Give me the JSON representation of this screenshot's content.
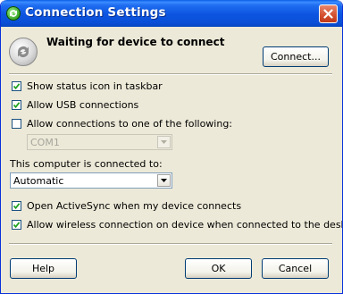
{
  "window": {
    "title": "Connection Settings"
  },
  "status": {
    "text": "Waiting for device to connect"
  },
  "buttons": {
    "connect": "Connect...",
    "help": "Help",
    "ok": "OK",
    "cancel": "Cancel"
  },
  "options": {
    "show_status_icon": {
      "label": "Show status icon in taskbar",
      "checked": true
    },
    "allow_usb": {
      "label": "Allow USB connections",
      "checked": true
    },
    "allow_connections": {
      "label": "Allow connections to one of the following:",
      "checked": false
    },
    "port": {
      "value": "COM1",
      "enabled": false
    },
    "connected_to_label": "This computer is connected to:",
    "connected_to": {
      "value": "Automatic"
    },
    "open_activesync": {
      "label": "Open ActiveSync when my device connects",
      "checked": true
    },
    "allow_wireless": {
      "label": "Allow wireless connection on device when connected to the desktop",
      "checked": true
    }
  },
  "icons": {
    "title": "activesync-icon",
    "status": "sync-arrows-icon",
    "close": "close-icon"
  },
  "colors": {
    "titlebar": "#0a54e0",
    "dialog_bg": "#ece9d8",
    "button_border": "#003c74",
    "check": "#21a121"
  }
}
